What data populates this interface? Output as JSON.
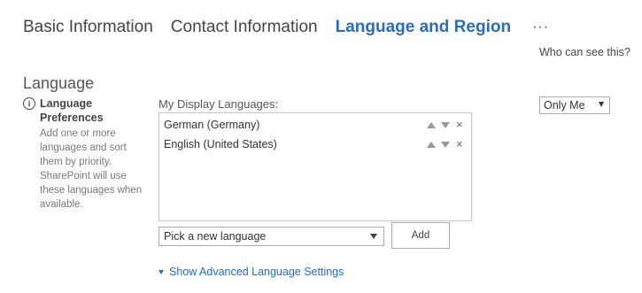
{
  "tabs": [
    {
      "label": "Basic Information",
      "active": false
    },
    {
      "label": "Contact Information",
      "active": false
    },
    {
      "label": "Language and Region",
      "active": true
    }
  ],
  "more_label": "···",
  "who_can_see": "Who can see this?",
  "section": {
    "title": "Language",
    "preferences": {
      "icon": "info-icon",
      "icon_glyph": "i",
      "title": "Language Preferences",
      "description": "Add one or more languages and sort them by priority. SharePoint will use these languages when available."
    }
  },
  "display_languages": {
    "label": "My Display Languages:",
    "items": [
      {
        "name": "German (Germany)"
      },
      {
        "name": "English (United States)"
      }
    ],
    "close_glyph": "×"
  },
  "picker": {
    "value": "Pick a new language"
  },
  "add_button": {
    "label": "Add"
  },
  "advanced_link": {
    "label": "Show Advanced Language Settings"
  },
  "visibility": {
    "value": "Only Me"
  },
  "colors": {
    "accent": "#2b6cb5",
    "text": "#444444",
    "muted": "#777777",
    "border": "#c6c6c6"
  }
}
